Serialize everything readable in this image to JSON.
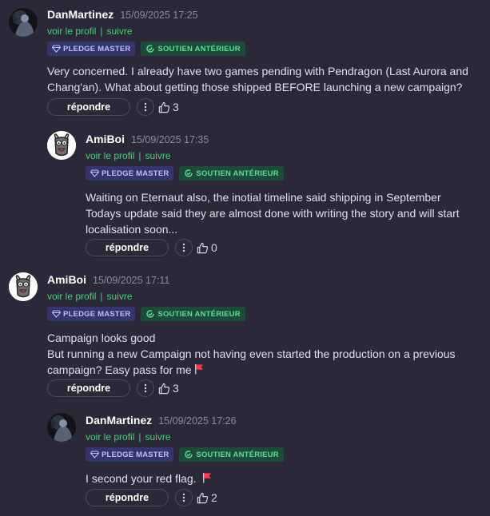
{
  "labels": {
    "profile": "voir le profil",
    "follow": "suivre",
    "separator": "|",
    "pledge_badge": "PLEDGE MASTER",
    "soutien_badge": "SOUTIEN ANTÉRIEUR",
    "reply": "répondre"
  },
  "colors": {
    "background": "#2b2838",
    "link_green": "#43d17a",
    "pledge_badge_bg": "#34366a",
    "soutien_badge_bg": "#1e4a3b",
    "flag_red": "#ff3b4f"
  },
  "comments": [
    {
      "author": "DanMartinez",
      "date": "15/09/2025 17:25",
      "avatar": "dark-figure-avatar",
      "lines": [
        "Very concerned. I already have two games pending with Pendragon (Last Aurora and Chang'an). What about getting those shipped BEFORE launching a new campaign?"
      ],
      "likes": "3"
    },
    {
      "author": "AmiBoi",
      "date": "15/09/2025 17:35",
      "avatar": "cartoon-face-avatar",
      "lines": [
        "Waiting on Eternaut also, the inotial timeline said shipping in September",
        "Todays update said they are almost done with writing the story and will start localisation soon..."
      ],
      "likes": "0"
    },
    {
      "author": "AmiBoi",
      "date": "15/09/2025 17:11",
      "avatar": "cartoon-face-avatar",
      "lines": [
        "Campaign looks good",
        "But running a new Campaign not having even started the production on a previous campaign? Easy pass for me"
      ],
      "flag_icon": "red-flag-icon",
      "likes": "3"
    },
    {
      "author": "DanMartinez",
      "date": "15/09/2025 17:26",
      "avatar": "dark-figure-avatar",
      "lines": [
        "I second your red flag."
      ],
      "flag_icon": "red-flag-icon",
      "likes": "2"
    }
  ]
}
